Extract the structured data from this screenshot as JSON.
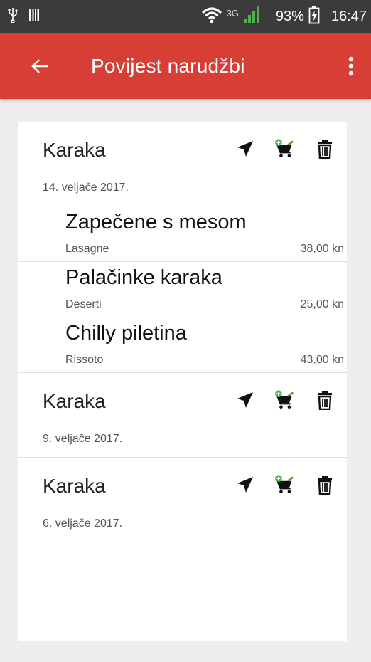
{
  "status_bar": {
    "network": "3G",
    "battery": "93%",
    "time": "16:47"
  },
  "app_bar": {
    "title": "Povijest narudžbi"
  },
  "icons": {
    "back": "arrow-left-icon",
    "menu": "more-vert-icon",
    "navigate": "navigation-arrow-icon",
    "reorder": "cart-add-icon",
    "delete": "trash-icon"
  },
  "colors": {
    "app_bar": "#d63e36",
    "cart": "#6c8d2f",
    "cart_plus": "#4caf50"
  },
  "orders": [
    {
      "restaurant": "Karaka",
      "date": "14. veljače 2017.",
      "items": [
        {
          "name": "Zapečene s mesom",
          "category": "Lasagne",
          "price": "38,00 kn"
        },
        {
          "name": "Palačinke karaka",
          "category": "Deserti",
          "price": "25,00 kn"
        },
        {
          "name": "Chilly piletina",
          "category": "Rissoto",
          "price": "43,00 kn"
        }
      ]
    },
    {
      "restaurant": "Karaka",
      "date": "9. veljače 2017.",
      "items": []
    },
    {
      "restaurant": "Karaka",
      "date": "6. veljače 2017.",
      "items": []
    }
  ]
}
